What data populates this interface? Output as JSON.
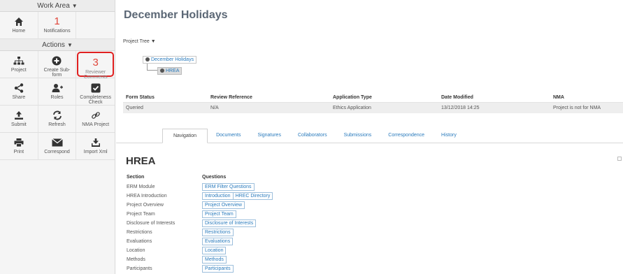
{
  "sidebar": {
    "work_area_label": "Work Area",
    "actions_label": "Actions",
    "home_label": "Home",
    "notifications_count": "1",
    "notifications_label": "Notifications",
    "project_label": "Project",
    "create_subform_label": "Create Sub-form",
    "reviewer_comments_count": "3",
    "reviewer_comments_label": "Reviewer Comments",
    "share_label": "Share",
    "roles_label": "Roles",
    "completeness_label": "Completeness Check",
    "submit_label": "Submit",
    "refresh_label": "Refresh",
    "nma_project_label": "NMA Project",
    "print_label": "Print",
    "correspond_label": "Correspond",
    "import_xml_label": "Import Xml"
  },
  "header": {
    "title": "December Holidays"
  },
  "project_tree": {
    "label": "Project Tree",
    "root": "December Holidays",
    "child": "HREA"
  },
  "status": {
    "headers": [
      "Form Status",
      "Review Reference",
      "Application Type",
      "Date Modified",
      "NMA"
    ],
    "values": [
      "Queried",
      "N/A",
      "Ethics Application",
      "13/12/2018 14:25",
      "Project is not for NMA"
    ]
  },
  "tabs": [
    "Navigation",
    "Documents",
    "Signatures",
    "Collaborators",
    "Submissions",
    "Correspondence",
    "History"
  ],
  "navigation": {
    "title": "HREA",
    "section_header": "Section",
    "questions_header": "Questions",
    "rows": [
      {
        "section": "ERM Module",
        "links": [
          "ERM Filter Questions"
        ]
      },
      {
        "section": "HREA Introduction",
        "links": [
          "Introduction",
          "HREC Directory"
        ]
      },
      {
        "section": "Project Overview",
        "links": [
          "Project Overview"
        ]
      },
      {
        "section": "Project Team",
        "links": [
          "Project Team"
        ]
      },
      {
        "section": "Disclosure of Interests",
        "links": [
          "Disclosure of Interests"
        ]
      },
      {
        "section": "Restrictions",
        "links": [
          "Restrictions"
        ]
      },
      {
        "section": "Evaluations",
        "links": [
          "Evaluations"
        ]
      },
      {
        "section": "Location",
        "links": [
          "Location"
        ]
      },
      {
        "section": "Methods",
        "links": [
          "Methods"
        ]
      },
      {
        "section": "Participants",
        "links": [
          "Participants"
        ]
      }
    ]
  },
  "colors": {
    "accent": "#2a7bbd",
    "highlight": "#e02020",
    "title": "#5b6775"
  }
}
